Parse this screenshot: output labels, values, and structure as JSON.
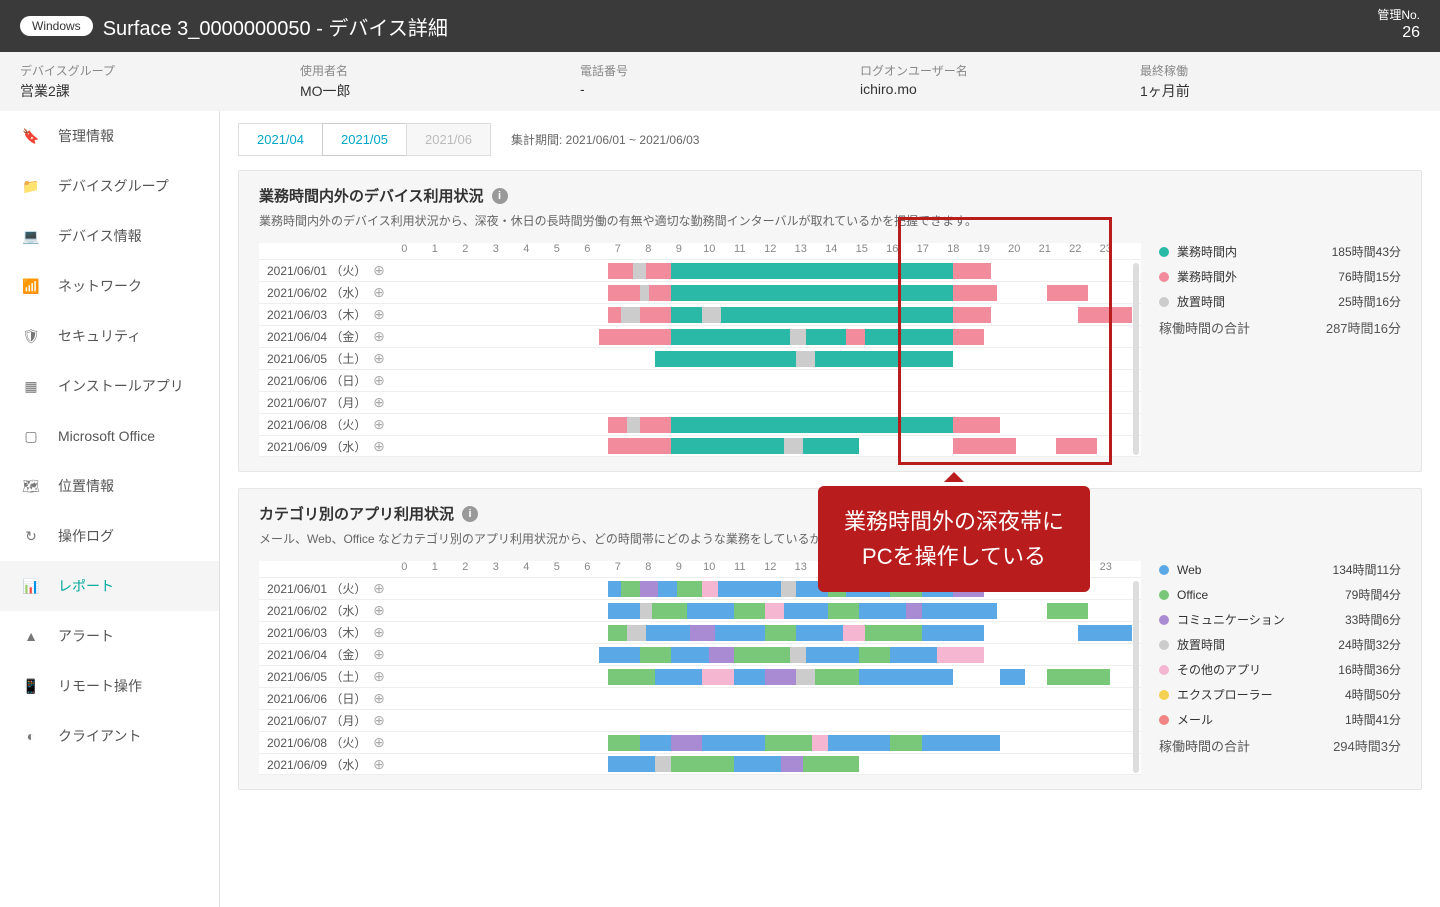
{
  "header": {
    "os_badge": "Windows",
    "title": "Surface 3_0000000050 - デバイス詳細",
    "mng_label": "管理No.",
    "mng_no": "26"
  },
  "info": [
    {
      "label": "デバイスグループ",
      "value": "営業2課"
    },
    {
      "label": "使用者名",
      "value": "MO一郎"
    },
    {
      "label": "電話番号",
      "value": "-"
    },
    {
      "label": "ログオンユーザー名",
      "value": "ichiro.mo"
    },
    {
      "label": "最終稼働",
      "value": "1ヶ月前"
    }
  ],
  "sidebar": [
    {
      "icon": "tag-icon",
      "label": "管理情報"
    },
    {
      "icon": "folder-icon",
      "label": "デバイスグループ"
    },
    {
      "icon": "laptop-icon",
      "label": "デバイス情報"
    },
    {
      "icon": "wifi-icon",
      "label": "ネットワーク"
    },
    {
      "icon": "shield-icon",
      "label": "セキュリティ"
    },
    {
      "icon": "grid-icon",
      "label": "インストールアプリ"
    },
    {
      "icon": "square-icon",
      "label": "Microsoft Office"
    },
    {
      "icon": "map-icon",
      "label": "位置情報"
    },
    {
      "icon": "history-icon",
      "label": "操作ログ"
    },
    {
      "icon": "chart-icon",
      "label": "レポート",
      "active": true
    },
    {
      "icon": "alert-icon",
      "label": "アラート"
    },
    {
      "icon": "remote-icon",
      "label": "リモート操作"
    },
    {
      "icon": "client-icon",
      "label": "クライアント"
    }
  ],
  "tabs": {
    "items": [
      "2021/04",
      "2021/05",
      "2021/06"
    ],
    "active_index": 1,
    "disabled_index": 2,
    "period_label": "集計期間: 2021/06/01 ~ 2021/06/03"
  },
  "panel1": {
    "title": "業務時間内外のデバイス利用状況",
    "desc": "業務時間内外のデバイス利用状況から、深夜・休日の長時間労働の有無や適切な勤務間インターバルが取れているかを把握できます。",
    "legend": [
      {
        "name": "業務時間内",
        "color": "#2bb9a7",
        "value": "185時間43分"
      },
      {
        "name": "業務時間外",
        "color": "#f28b9b",
        "value": "76時間15分"
      },
      {
        "name": "放置時間",
        "color": "#cccccc",
        "value": "25時間16分"
      }
    ],
    "total_label": "稼働時間の合計",
    "total_value": "287時間16分"
  },
  "panel2": {
    "title": "カテゴリ別のアプリ利用状況",
    "desc": "メール、Web、Office などカテゴリ別のアプリ利用状況から、どの時間帯にどのような業務をしているかを把握できます。",
    "legend": [
      {
        "name": "Web",
        "color": "#5aa9e6",
        "value": "134時間11分"
      },
      {
        "name": "Office",
        "color": "#79c879",
        "value": "79時間4分"
      },
      {
        "name": "コミュニケーション",
        "color": "#a98bd4",
        "value": "33時間6分"
      },
      {
        "name": "放置時間",
        "color": "#cccccc",
        "value": "24時間32分"
      },
      {
        "name": "その他のアプリ",
        "color": "#f4b6d1",
        "value": "16時間36分"
      },
      {
        "name": "エクスプローラー",
        "color": "#f5d152",
        "value": "4時間50分"
      },
      {
        "name": "メール",
        "color": "#f08585",
        "value": "1時間41分"
      }
    ],
    "total_label": "稼働時間の合計",
    "total_value": "294時間3分"
  },
  "callout": {
    "line1": "業務時間外の深夜帯に",
    "line2": "PCを操作している"
  },
  "chart_data": {
    "hours": [
      "0",
      "1",
      "2",
      "3",
      "4",
      "5",
      "6",
      "7",
      "8",
      "9",
      "10",
      "11",
      "12",
      "13",
      "14",
      "15",
      "16",
      "17",
      "18",
      "19",
      "20",
      "21",
      "22",
      "23"
    ],
    "dates": [
      "2021/06/01 （火）",
      "2021/06/02 （水）",
      "2021/06/03 （木）",
      "2021/06/04 （金）",
      "2021/06/05 （土）",
      "2021/06/06 （日）",
      "2021/06/07 （月）",
      "2021/06/08 （火）",
      "2021/06/09 （水）"
    ],
    "panel1_rows": [
      [
        {
          "s": 7,
          "e": 7.8,
          "c": "over"
        },
        {
          "s": 7.8,
          "e": 8.2,
          "c": "idle"
        },
        {
          "s": 8.2,
          "e": 9,
          "c": "over"
        },
        {
          "s": 9,
          "e": 18,
          "c": "work"
        },
        {
          "s": 18,
          "e": 19.2,
          "c": "over"
        }
      ],
      [
        {
          "s": 7,
          "e": 8,
          "c": "over"
        },
        {
          "s": 8,
          "e": 8.3,
          "c": "idle"
        },
        {
          "s": 8.3,
          "e": 9,
          "c": "over"
        },
        {
          "s": 9,
          "e": 18,
          "c": "work"
        },
        {
          "s": 18,
          "e": 19.4,
          "c": "over"
        },
        {
          "s": 21,
          "e": 22.3,
          "c": "over"
        }
      ],
      [
        {
          "s": 7,
          "e": 7.4,
          "c": "over"
        },
        {
          "s": 7.4,
          "e": 8,
          "c": "idle"
        },
        {
          "s": 8,
          "e": 9,
          "c": "over"
        },
        {
          "s": 9,
          "e": 10,
          "c": "work"
        },
        {
          "s": 10,
          "e": 10.6,
          "c": "idle"
        },
        {
          "s": 10.6,
          "e": 18,
          "c": "work"
        },
        {
          "s": 18,
          "e": 19.2,
          "c": "over"
        },
        {
          "s": 22,
          "e": 23.7,
          "c": "over"
        }
      ],
      [
        {
          "s": 6.7,
          "e": 9,
          "c": "over"
        },
        {
          "s": 9,
          "e": 12.8,
          "c": "work"
        },
        {
          "s": 12.8,
          "e": 13.3,
          "c": "idle"
        },
        {
          "s": 13.3,
          "e": 14.6,
          "c": "work"
        },
        {
          "s": 14.6,
          "e": 15.2,
          "c": "over"
        },
        {
          "s": 15.2,
          "e": 18,
          "c": "work"
        },
        {
          "s": 18,
          "e": 19,
          "c": "over"
        }
      ],
      [
        {
          "s": 8.5,
          "e": 13,
          "c": "work"
        },
        {
          "s": 13,
          "e": 13.6,
          "c": "idle"
        },
        {
          "s": 13.6,
          "e": 18,
          "c": "work"
        }
      ],
      [],
      [],
      [
        {
          "s": 7,
          "e": 7.6,
          "c": "over"
        },
        {
          "s": 7.6,
          "e": 8,
          "c": "idle"
        },
        {
          "s": 8,
          "e": 9,
          "c": "over"
        },
        {
          "s": 9,
          "e": 18,
          "c": "work"
        },
        {
          "s": 18,
          "e": 19.5,
          "c": "over"
        }
      ],
      [
        {
          "s": 7,
          "e": 9,
          "c": "over"
        },
        {
          "s": 9,
          "e": 12.6,
          "c": "work"
        },
        {
          "s": 12.6,
          "e": 13.2,
          "c": "idle"
        },
        {
          "s": 13.2,
          "e": 15,
          "c": "work"
        },
        {
          "s": 18,
          "e": 20,
          "c": "over"
        },
        {
          "s": 21.3,
          "e": 22.6,
          "c": "over"
        }
      ]
    ],
    "panel2_rows": [
      [
        {
          "s": 7,
          "e": 7.4,
          "c": "web"
        },
        {
          "s": 7.4,
          "e": 8,
          "c": "office"
        },
        {
          "s": 8,
          "e": 8.6,
          "c": "comm"
        },
        {
          "s": 8.6,
          "e": 9.2,
          "c": "web"
        },
        {
          "s": 9.2,
          "e": 10,
          "c": "office"
        },
        {
          "s": 10,
          "e": 10.5,
          "c": "other"
        },
        {
          "s": 10.5,
          "e": 12.5,
          "c": "web"
        },
        {
          "s": 12.5,
          "e": 13,
          "c": "idle"
        },
        {
          "s": 13,
          "e": 14,
          "c": "web"
        },
        {
          "s": 14,
          "e": 14.6,
          "c": "office"
        },
        {
          "s": 14.6,
          "e": 16,
          "c": "web"
        },
        {
          "s": 16,
          "e": 17,
          "c": "office"
        },
        {
          "s": 17,
          "e": 18,
          "c": "web"
        },
        {
          "s": 18,
          "e": 19,
          "c": "comm"
        }
      ],
      [
        {
          "s": 7,
          "e": 8,
          "c": "web"
        },
        {
          "s": 8,
          "e": 8.4,
          "c": "idle"
        },
        {
          "s": 8.4,
          "e": 9.5,
          "c": "office"
        },
        {
          "s": 9.5,
          "e": 11,
          "c": "web"
        },
        {
          "s": 11,
          "e": 12,
          "c": "office"
        },
        {
          "s": 12,
          "e": 12.6,
          "c": "other"
        },
        {
          "s": 12.6,
          "e": 14,
          "c": "web"
        },
        {
          "s": 14,
          "e": 15,
          "c": "office"
        },
        {
          "s": 15,
          "e": 16.5,
          "c": "web"
        },
        {
          "s": 16.5,
          "e": 17,
          "c": "comm"
        },
        {
          "s": 17,
          "e": 19.4,
          "c": "web"
        },
        {
          "s": 21,
          "e": 22.3,
          "c": "office"
        }
      ],
      [
        {
          "s": 7,
          "e": 7.6,
          "c": "office"
        },
        {
          "s": 7.6,
          "e": 8.2,
          "c": "idle"
        },
        {
          "s": 8.2,
          "e": 9.6,
          "c": "web"
        },
        {
          "s": 9.6,
          "e": 10.4,
          "c": "comm"
        },
        {
          "s": 10.4,
          "e": 12,
          "c": "web"
        },
        {
          "s": 12,
          "e": 13,
          "c": "office"
        },
        {
          "s": 13,
          "e": 14.5,
          "c": "web"
        },
        {
          "s": 14.5,
          "e": 15.2,
          "c": "other"
        },
        {
          "s": 15.2,
          "e": 17,
          "c": "office"
        },
        {
          "s": 17,
          "e": 19,
          "c": "web"
        },
        {
          "s": 22,
          "e": 23.7,
          "c": "web"
        }
      ],
      [
        {
          "s": 6.7,
          "e": 8,
          "c": "web"
        },
        {
          "s": 8,
          "e": 9,
          "c": "office"
        },
        {
          "s": 9,
          "e": 10.2,
          "c": "web"
        },
        {
          "s": 10.2,
          "e": 11,
          "c": "comm"
        },
        {
          "s": 11,
          "e": 12.8,
          "c": "office"
        },
        {
          "s": 12.8,
          "e": 13.3,
          "c": "idle"
        },
        {
          "s": 13.3,
          "e": 15,
          "c": "web"
        },
        {
          "s": 15,
          "e": 16,
          "c": "office"
        },
        {
          "s": 16,
          "e": 17.5,
          "c": "web"
        },
        {
          "s": 17.5,
          "e": 19,
          "c": "other"
        }
      ],
      [
        {
          "s": 7,
          "e": 8.5,
          "c": "office"
        },
        {
          "s": 8.5,
          "e": 10,
          "c": "web"
        },
        {
          "s": 10,
          "e": 11,
          "c": "other"
        },
        {
          "s": 11,
          "e": 12,
          "c": "web"
        },
        {
          "s": 12,
          "e": 13,
          "c": "comm"
        },
        {
          "s": 13,
          "e": 13.6,
          "c": "idle"
        },
        {
          "s": 13.6,
          "e": 15,
          "c": "office"
        },
        {
          "s": 15,
          "e": 18,
          "c": "web"
        },
        {
          "s": 19.5,
          "e": 20.3,
          "c": "web"
        },
        {
          "s": 21,
          "e": 23,
          "c": "office"
        }
      ],
      [],
      [],
      [
        {
          "s": 7,
          "e": 8,
          "c": "office"
        },
        {
          "s": 8,
          "e": 9,
          "c": "web"
        },
        {
          "s": 9,
          "e": 10,
          "c": "comm"
        },
        {
          "s": 10,
          "e": 12,
          "c": "web"
        },
        {
          "s": 12,
          "e": 13.5,
          "c": "office"
        },
        {
          "s": 13.5,
          "e": 14,
          "c": "other"
        },
        {
          "s": 14,
          "e": 16,
          "c": "web"
        },
        {
          "s": 16,
          "e": 17,
          "c": "office"
        },
        {
          "s": 17,
          "e": 19.5,
          "c": "web"
        }
      ],
      [
        {
          "s": 7,
          "e": 8.5,
          "c": "web"
        },
        {
          "s": 8.5,
          "e": 9,
          "c": "idle"
        },
        {
          "s": 9,
          "e": 11,
          "c": "office"
        },
        {
          "s": 11,
          "e": 12.5,
          "c": "web"
        },
        {
          "s": 12.5,
          "e": 13.2,
          "c": "comm"
        },
        {
          "s": 13.2,
          "e": 15,
          "c": "office"
        }
      ]
    ]
  }
}
